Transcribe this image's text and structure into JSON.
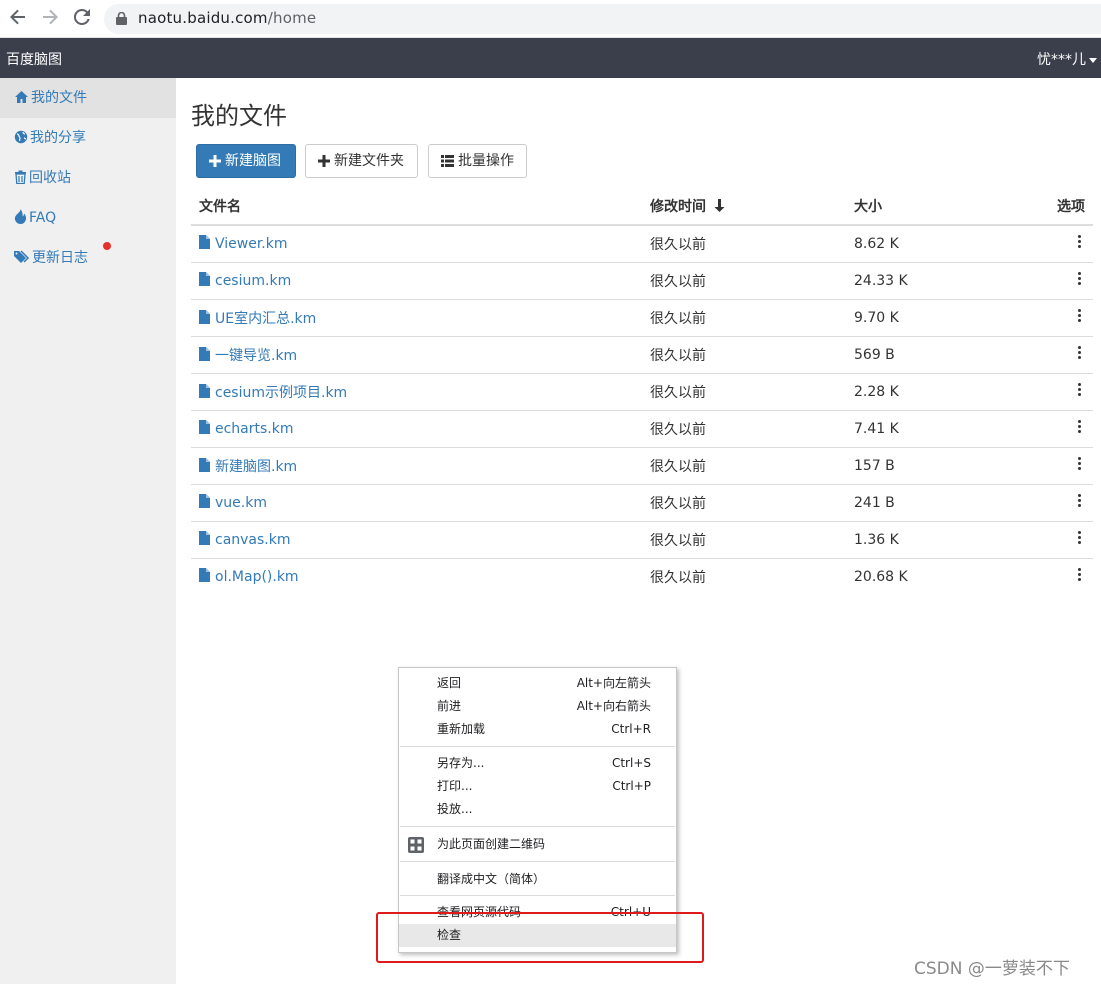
{
  "browser": {
    "url_host": "naotu.baidu.com",
    "url_path": "/home"
  },
  "header": {
    "brand": "百度脑图",
    "user": "忧***儿"
  },
  "sidebar": {
    "items": [
      {
        "label": "我的文件",
        "icon": "home-icon",
        "active": true
      },
      {
        "label": "我的分享",
        "icon": "globe-icon"
      },
      {
        "label": "回收站",
        "icon": "trash-icon"
      },
      {
        "label": "FAQ",
        "icon": "fire-icon"
      },
      {
        "label": "更新日志",
        "icon": "tags-icon",
        "badge": "red-dot"
      }
    ]
  },
  "main": {
    "title": "我的文件",
    "buttons": {
      "new_map": "新建脑图",
      "new_folder": "新建文件夹",
      "batch": "批量操作"
    },
    "table": {
      "headers": {
        "name": "文件名",
        "time": "修改时间",
        "size": "大小",
        "options": "选项"
      },
      "rows": [
        {
          "name": "Viewer.km",
          "time": "很久以前",
          "size": "8.62 K"
        },
        {
          "name": "cesium.km",
          "time": "很久以前",
          "size": "24.33 K"
        },
        {
          "name": "UE室内汇总.km",
          "time": "很久以前",
          "size": "9.70 K"
        },
        {
          "name": "一键导览.km",
          "time": "很久以前",
          "size": "569 B"
        },
        {
          "name": "cesium示例项目.km",
          "time": "很久以前",
          "size": "2.28 K"
        },
        {
          "name": "echarts.km",
          "time": "很久以前",
          "size": "7.41 K"
        },
        {
          "name": "新建脑图.km",
          "time": "很久以前",
          "size": "157 B"
        },
        {
          "name": "vue.km",
          "time": "很久以前",
          "size": "241 B"
        },
        {
          "name": "canvas.km",
          "time": "很久以前",
          "size": "1.36 K"
        },
        {
          "name": "ol.Map().km",
          "time": "很久以前",
          "size": "20.68 K"
        }
      ]
    }
  },
  "context_menu": {
    "back": "返回",
    "back_sc": "Alt+向左箭头",
    "forward": "前进",
    "forward_sc": "Alt+向右箭头",
    "reload": "重新加载",
    "reload_sc": "Ctrl+R",
    "save_as": "另存为...",
    "save_as_sc": "Ctrl+S",
    "print": "打印...",
    "print_sc": "Ctrl+P",
    "cast": "投放...",
    "qr": "为此页面创建二维码",
    "translate": "翻译成中文（简体）",
    "view_source": "查看网页源代码",
    "view_source_sc": "Ctrl+U",
    "inspect": "检查"
  },
  "watermark": "CSDN @一萝装不下",
  "colors": {
    "topbar": "#3b3f4c",
    "link": "#337ab7",
    "primary": "#337ab7",
    "highlight_box": "#e0191b"
  }
}
